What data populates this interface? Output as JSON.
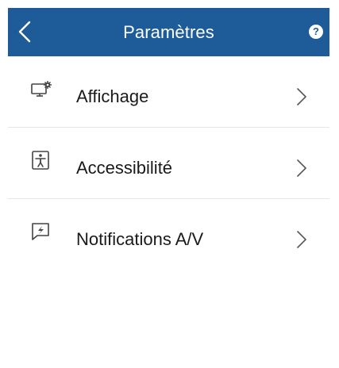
{
  "header": {
    "title": "Paramètres",
    "back_icon": "chevron-left-icon",
    "help_icon": "question-circle-icon",
    "help_glyph": "?",
    "background_color": "#1d5c98"
  },
  "settings": {
    "items": [
      {
        "label": "Affichage",
        "icon": "display-settings-icon"
      },
      {
        "label": "Accessibilité",
        "icon": "accessibility-icon"
      },
      {
        "label": "Notifications A/V",
        "icon": "av-notification-icon"
      }
    ]
  }
}
